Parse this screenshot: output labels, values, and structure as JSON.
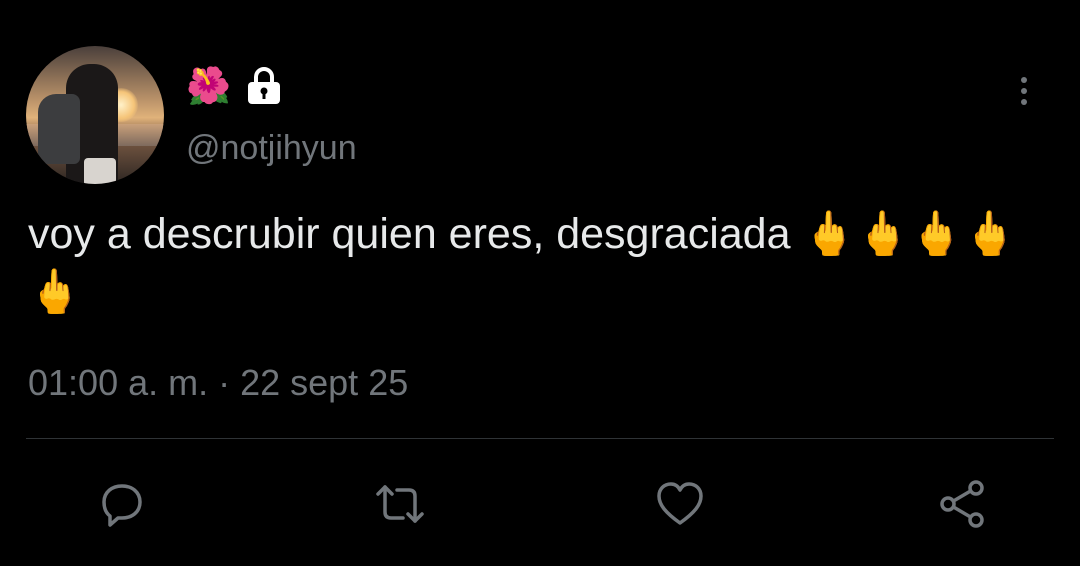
{
  "profile": {
    "avatar_icon": "profile-photo",
    "name_emoji": "🌺",
    "lock_icon": "lock-icon",
    "handle": "@notjihyun"
  },
  "menu": {
    "icon": "more-vertical-icon"
  },
  "tweet": {
    "text": "voy a descrubir quien eres, desgraciada 🖕🖕🖕🖕🖕",
    "timestamp": "01:00 a. m. · 22 sept 25"
  },
  "actions": [
    {
      "icon": "reply-icon"
    },
    {
      "icon": "retweet-icon"
    },
    {
      "icon": "like-icon"
    },
    {
      "icon": "share-icon"
    }
  ],
  "colors": {
    "background": "#000000",
    "text": "#e7e9ea",
    "secondary": "#71767b",
    "divider": "#2f3336"
  }
}
